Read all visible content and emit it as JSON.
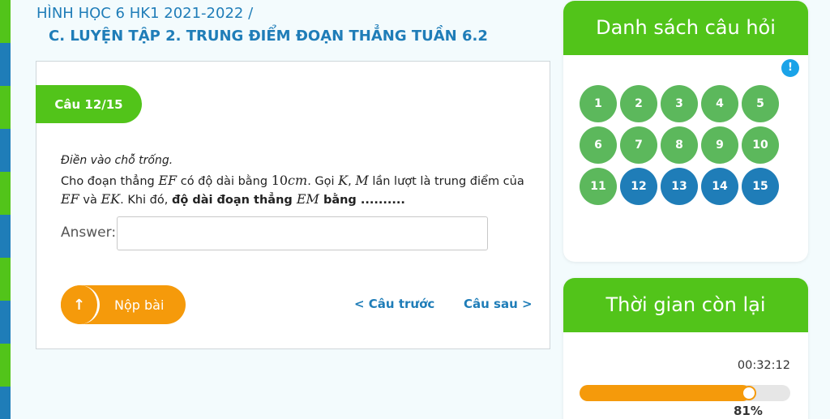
{
  "breadcrumb": "HÌNH HỌC 6 HK1 2021-2022 /",
  "lesson_title": "C. LUYỆN TẬP 2. TRUNG ĐIỂM ĐOẠN THẲNG TUẦN 6.2",
  "question": {
    "badge": "Câu 12/15",
    "instruction": "Điền vào chỗ trống.",
    "line1": {
      "t1": "Cho đoạn thẳng ",
      "m1": "EF",
      "t2": " có độ dài bằng ",
      "n1": "10",
      "m2": "cm",
      "t3": ". Gọi ",
      "m3": "K",
      "t4": ", ",
      "m4": "M",
      "t5": " lần lượt là trung điểm của"
    },
    "line2": {
      "m1": "EF",
      "t1": " và ",
      "m2": "EK",
      "t2": ". Khi đó, ",
      "b1": "độ dài đoạn thẳng ",
      "m3": "EM",
      "b2": " bằng .........."
    },
    "answer_label": "Answer:",
    "answer_value": ""
  },
  "actions": {
    "submit_icon": "↑",
    "submit_label": "Nộp bài",
    "prev_label": "< Câu trước",
    "next_label": "Câu sau >"
  },
  "question_list": {
    "title": "Danh sách câu hỏi",
    "info_icon": "!",
    "items": [
      {
        "num": "1",
        "status": "answered"
      },
      {
        "num": "2",
        "status": "answered"
      },
      {
        "num": "3",
        "status": "answered"
      },
      {
        "num": "4",
        "status": "answered"
      },
      {
        "num": "5",
        "status": "answered"
      },
      {
        "num": "6",
        "status": "answered"
      },
      {
        "num": "7",
        "status": "answered"
      },
      {
        "num": "8",
        "status": "answered"
      },
      {
        "num": "9",
        "status": "answered"
      },
      {
        "num": "10",
        "status": "answered"
      },
      {
        "num": "11",
        "status": "answered"
      },
      {
        "num": "12",
        "status": "pending"
      },
      {
        "num": "13",
        "status": "pending"
      },
      {
        "num": "14",
        "status": "pending"
      },
      {
        "num": "15",
        "status": "pending"
      }
    ]
  },
  "timer": {
    "title": "Thời gian còn lại",
    "time_left": "00:32:12",
    "progress_fraction": 0.81,
    "progress_label": "81%"
  },
  "colors": {
    "green": "#52c41a",
    "blue": "#1f7db8",
    "orange": "#f59a0b",
    "circle_green": "#5cb85c",
    "circle_blue": "#1f7db8"
  }
}
